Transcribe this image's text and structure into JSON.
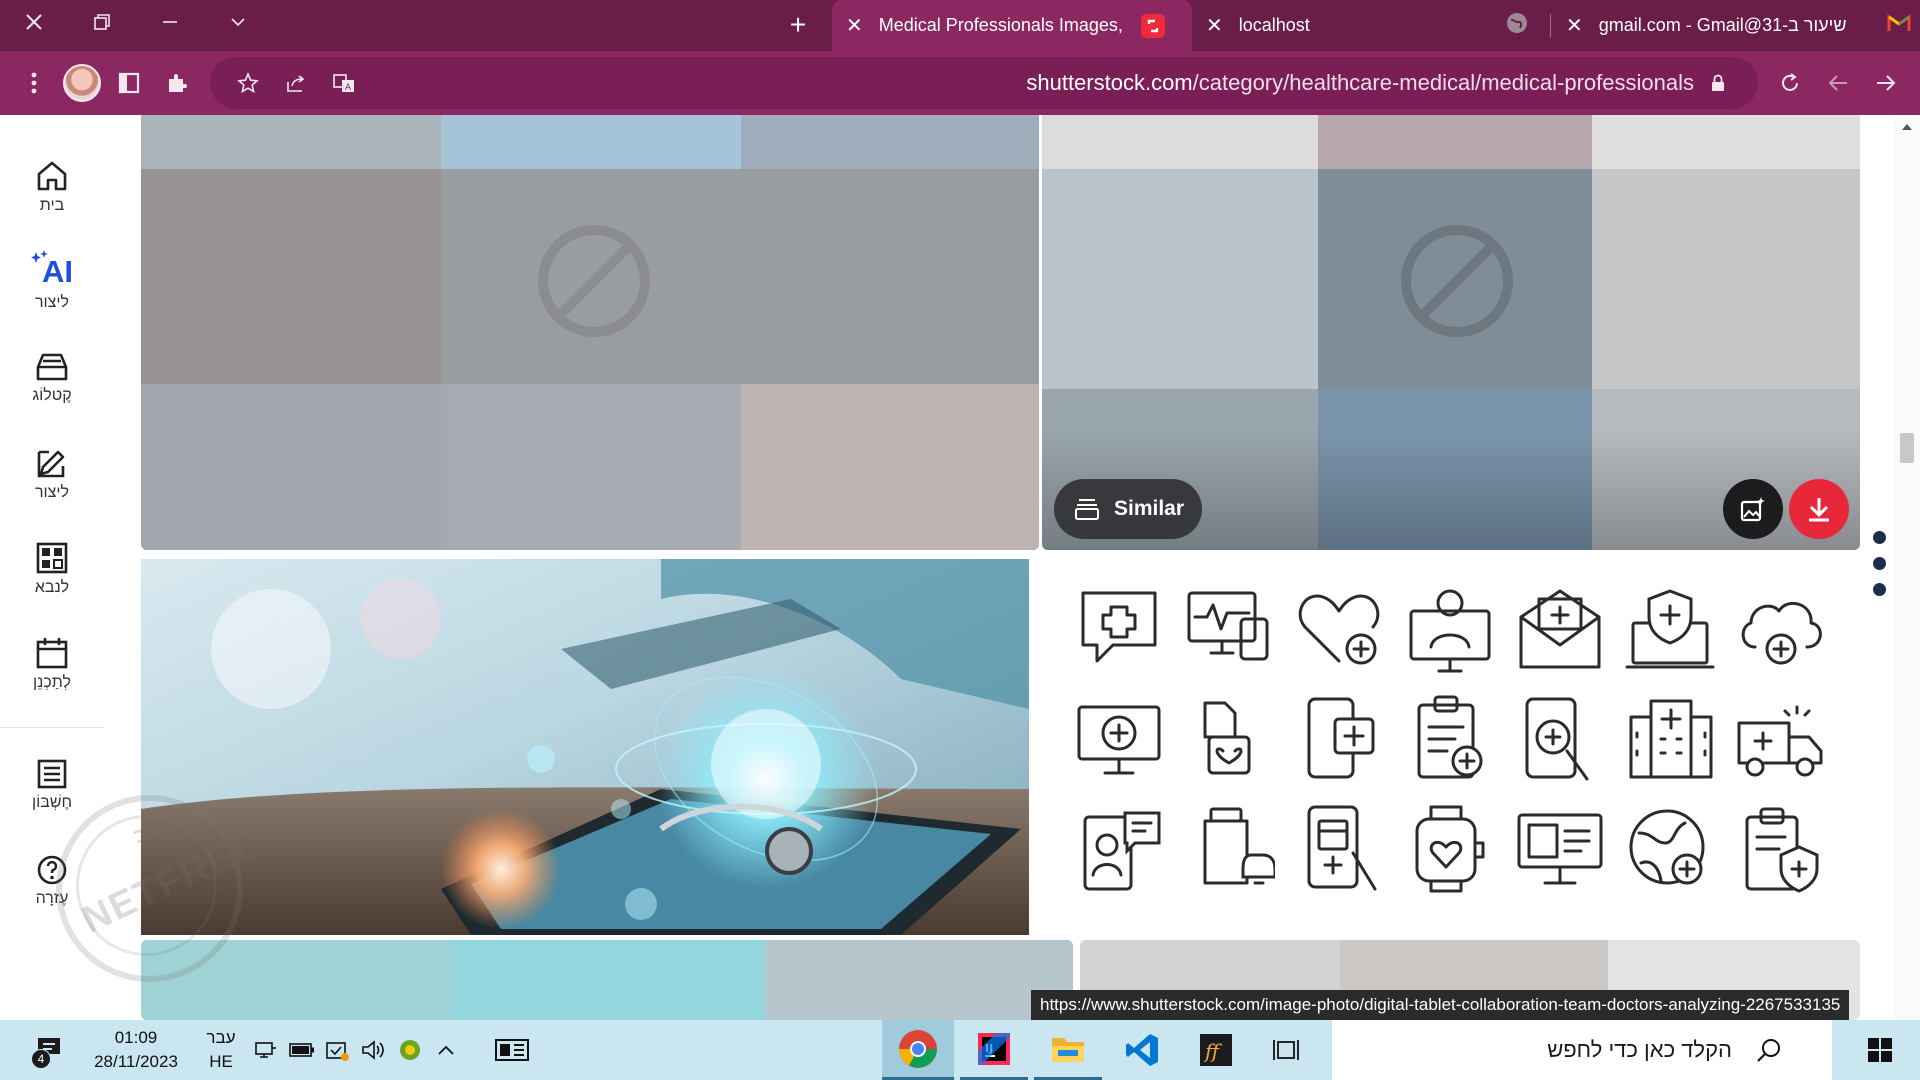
{
  "browser": {
    "tabs": [
      {
        "label": "Medical Professionals Images, Pi",
        "active": true,
        "close": "close-icon",
        "favicon": "shutterstock-icon"
      },
      {
        "label": "localhost",
        "active": false,
        "close": "close-icon",
        "favicon": "globe-icon"
      },
      {
        "label": "שיעור ב-31@gmail.com - Gmail",
        "active": false,
        "close": "close-icon",
        "favicon": "gmail-icon"
      }
    ],
    "window_controls": [
      "close-icon",
      "restore-icon",
      "minimize-icon",
      "tab-search-icon"
    ],
    "new_tab": "+",
    "url_host": "shutterstock.com",
    "url_path": "/category/healthcare-medical/medical-professionals",
    "colors": {
      "frame": "#6b1d4a",
      "toolbar": "#8b2861",
      "active_tab": "#8b2861"
    }
  },
  "sidebar": {
    "items": [
      {
        "label": "בית",
        "icon": "home-icon"
      },
      {
        "label": "ליצור",
        "icon": "ai-sparkle-icon",
        "icon_text": "AI"
      },
      {
        "label": "קֶטלוֹג",
        "icon": "catalog-icon"
      },
      {
        "label": "ליצור",
        "icon": "edit-icon"
      },
      {
        "label": "לנבא",
        "icon": "grid-icon"
      },
      {
        "label": "לְתַכְנֵן",
        "icon": "calendar-icon"
      },
      {
        "label": "חֶשְׁבּוֹן",
        "icon": "list-icon"
      },
      {
        "label": "עֶזרָה",
        "icon": "help-icon"
      }
    ]
  },
  "content": {
    "similar_label": "Similar",
    "colors": {
      "download": "#e8273a",
      "ai_button": "#1c1c1e",
      "scroll_dots": "#1b2f4d"
    },
    "blocked_icon": "blocked-icon",
    "icon_grid": [
      "medical-chat-icon",
      "health-monitor-icon",
      "heart-plus-icon",
      "telemedicine-doctor-icon",
      "medical-mail-icon",
      "laptop-shield-icon",
      "cloud-plus-icon",
      "monitor-plus-icon",
      "smartwatch-heart-icon",
      "phone-plus-icon",
      "clipboard-plus-icon",
      "phone-search-icon",
      "hospital-building-icon",
      "ambulance-icon",
      "video-consult-icon",
      "pill-bottle-bell-icon",
      "phone-calendar-icon",
      "watch-pulse-icon",
      "monitor-profile-icon",
      "globe-plus-icon",
      "clipboard-shield-icon"
    ]
  },
  "status_bar": {
    "url": "https://www.shutterstock.com/image-photo/digital-tablet-collaboration-team-doctors-analyzing-2267533135"
  },
  "taskbar": {
    "search_placeholder": "הקלד כאן כדי לחפש",
    "time": "01:09",
    "date": "28/11/2023",
    "lang_top": "עבר",
    "lang_bottom": "HE",
    "notification_count": "4",
    "apps": [
      "chrome-icon",
      "intellij-icon",
      "file-explorer-icon",
      "vscode-icon",
      "fontforge-icon",
      "task-view-icon"
    ]
  },
  "watermark": {
    "text": "NETFREE",
    "top_text": "מחשב"
  }
}
